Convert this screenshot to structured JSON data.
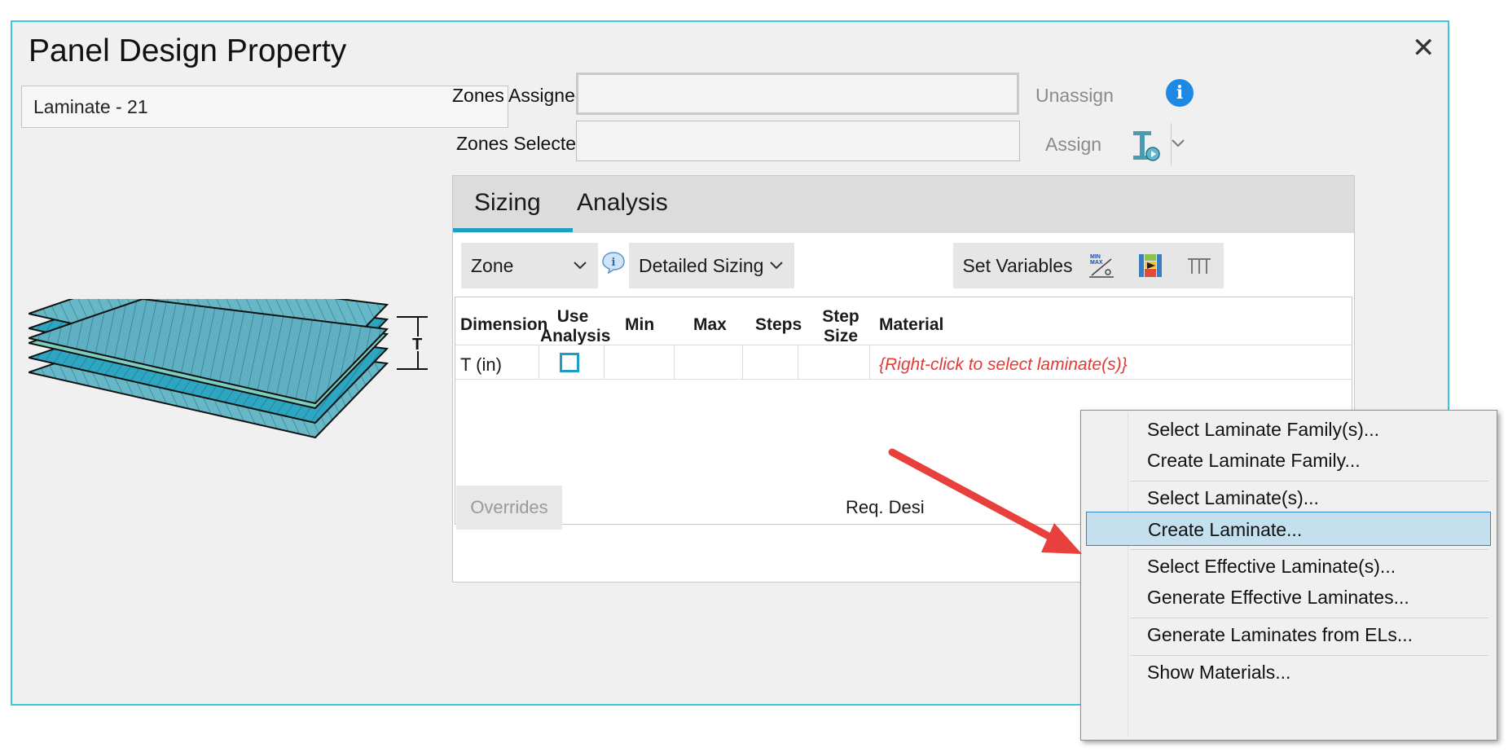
{
  "dialog": {
    "title": "Panel Design Property",
    "close_glyph": "✕",
    "property_name": "Laminate - 21"
  },
  "illustration": {
    "thickness_label": "T"
  },
  "zones": {
    "assigned_label": "Zones Assigned:",
    "assigned_value": "",
    "selected_label": "Zones Selected:",
    "selected_value": "",
    "unassign_label": "Unassign",
    "assign_label": "Assign"
  },
  "tabs": [
    {
      "label": "Sizing",
      "active": true
    },
    {
      "label": "Analysis",
      "active": false
    }
  ],
  "sizing": {
    "scope_select": "Zone",
    "mode_select": "Detailed Sizing",
    "set_variables_label": "Set Variables",
    "columns": [
      "Dimension",
      "Use Analysis",
      "Min",
      "Max",
      "Steps",
      "Step Size",
      "Material"
    ],
    "header_lines": {
      "use_analysis": [
        "Use",
        "Analysis"
      ],
      "step_size": [
        "Step",
        "Size"
      ]
    },
    "rows": [
      {
        "dimension": "T (in)",
        "use_analysis": false,
        "min": "",
        "max": "",
        "steps": "",
        "step_size": "",
        "material": "{Right-click to select laminate(s)}"
      }
    ],
    "overrides_label": "Overrides",
    "req_text": "Req. Desi"
  },
  "context_menu": {
    "items": [
      {
        "label": "Select Laminate Family(s)...",
        "highlighted": false
      },
      {
        "label": "Create Laminate Family...",
        "highlighted": false
      },
      {
        "label": "Select Laminate(s)...",
        "highlighted": false
      },
      {
        "label": "Create Laminate...",
        "highlighted": true
      },
      {
        "label": "Select Effective Laminate(s)...",
        "highlighted": false
      },
      {
        "label": "Generate Effective Laminates...",
        "highlighted": false
      },
      {
        "label": "Generate Laminates from ELs...",
        "highlighted": false
      },
      {
        "label": "Show Materials...",
        "highlighted": false
      }
    ]
  },
  "icons": [
    "close-icon",
    "info-icon",
    "tool-icon",
    "chevron-down-icon",
    "min-max-icon",
    "grid-color-icon",
    "columns-icon"
  ],
  "colors": {
    "accent": "#1e9ec4",
    "dialog_border": "#3cc8e0",
    "info_blue": "#1e88e5",
    "hint_red": "#e53935",
    "arrow_red": "#e8403c",
    "menu_highlight": "#c4e0ef"
  }
}
